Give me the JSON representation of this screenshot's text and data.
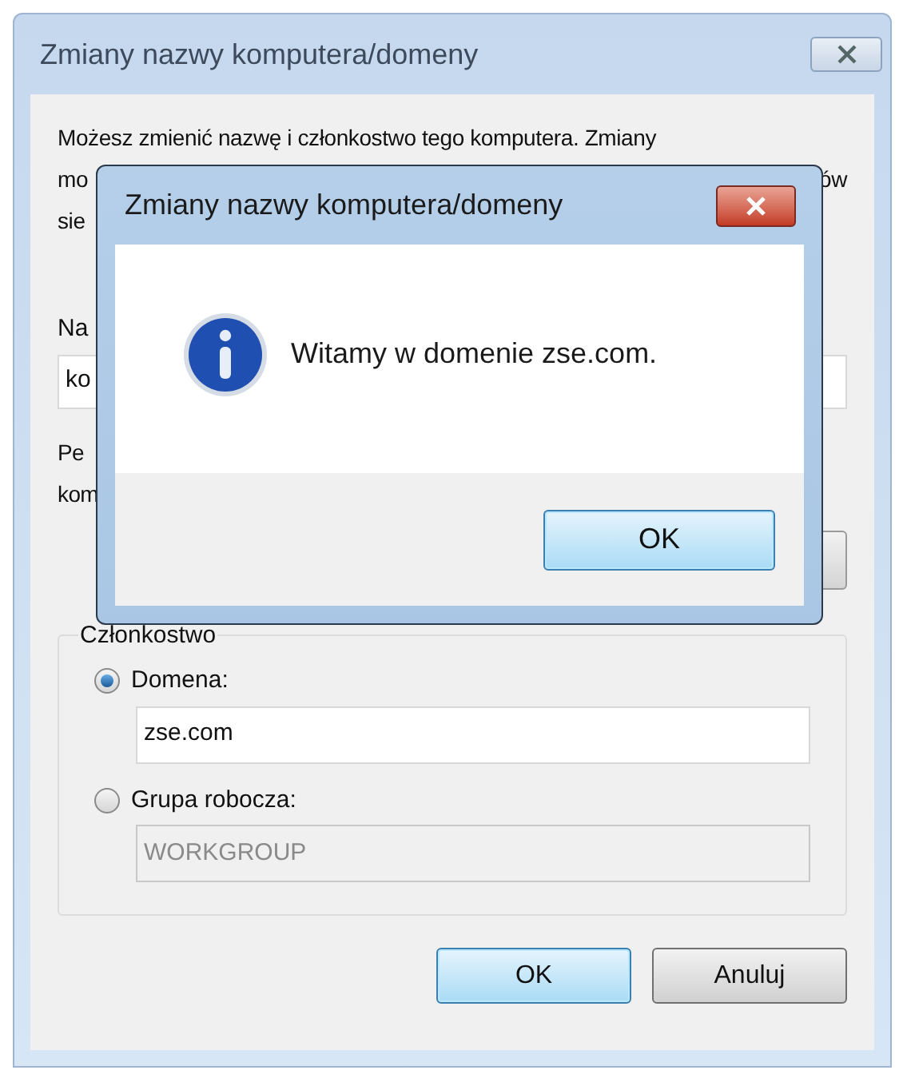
{
  "dialog": {
    "title": "Zmiany nazwy komputera/domeny",
    "intro": {
      "line_1": "Możesz zmienić nazwę i członkostwo tego komputera. Zmiany",
      "line_2_start": "mo",
      "line_2_end": "ów",
      "line_3_start": "sie"
    },
    "computer_name": {
      "label": "Na",
      "value": "ko"
    },
    "full_name": {
      "label_line_1": "Pe",
      "label_line_2": "kom"
    },
    "membership": {
      "title": "Członkostwo",
      "options": [
        {
          "label": "Domena:",
          "selected": true,
          "value": "zse.com",
          "disabled": false
        },
        {
          "label": "Grupa robocza:",
          "selected": false,
          "value": "WORKGROUP",
          "disabled": true
        }
      ]
    },
    "buttons": [
      {
        "label": "OK",
        "default": true
      },
      {
        "label": "Anuluj",
        "default": false
      }
    ]
  },
  "message_box": {
    "title": "Zmiany nazwy komputera/domeny",
    "text": "Witamy w domenie zse.com.",
    "button": {
      "label": "OK",
      "default": true
    }
  }
}
